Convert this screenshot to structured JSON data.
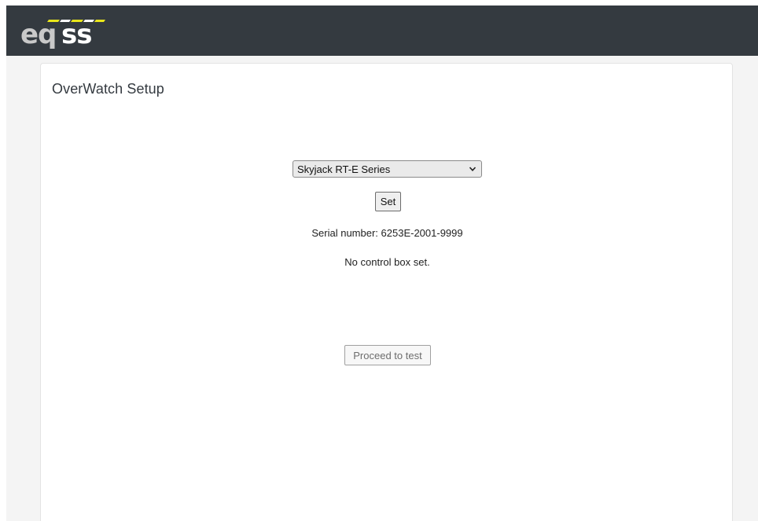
{
  "header": {
    "logo_text": "eqss",
    "colors": {
      "bar": "#343a40",
      "logo_light": "#c9c9c9",
      "logo_white": "#ffffff",
      "accent_yellow": "#e9e61a"
    }
  },
  "setup_card": {
    "title": "OverWatch Setup",
    "model_select": {
      "selected": "Skyjack RT-E Series",
      "icon": "chevron-down-icon"
    },
    "set_button_label": "Set",
    "serial_number_text": "Serial number: 6253E-2001-9999",
    "control_box_status": "No control box set.",
    "proceed_button_label": "Proceed to test",
    "proceed_button_disabled": true
  }
}
